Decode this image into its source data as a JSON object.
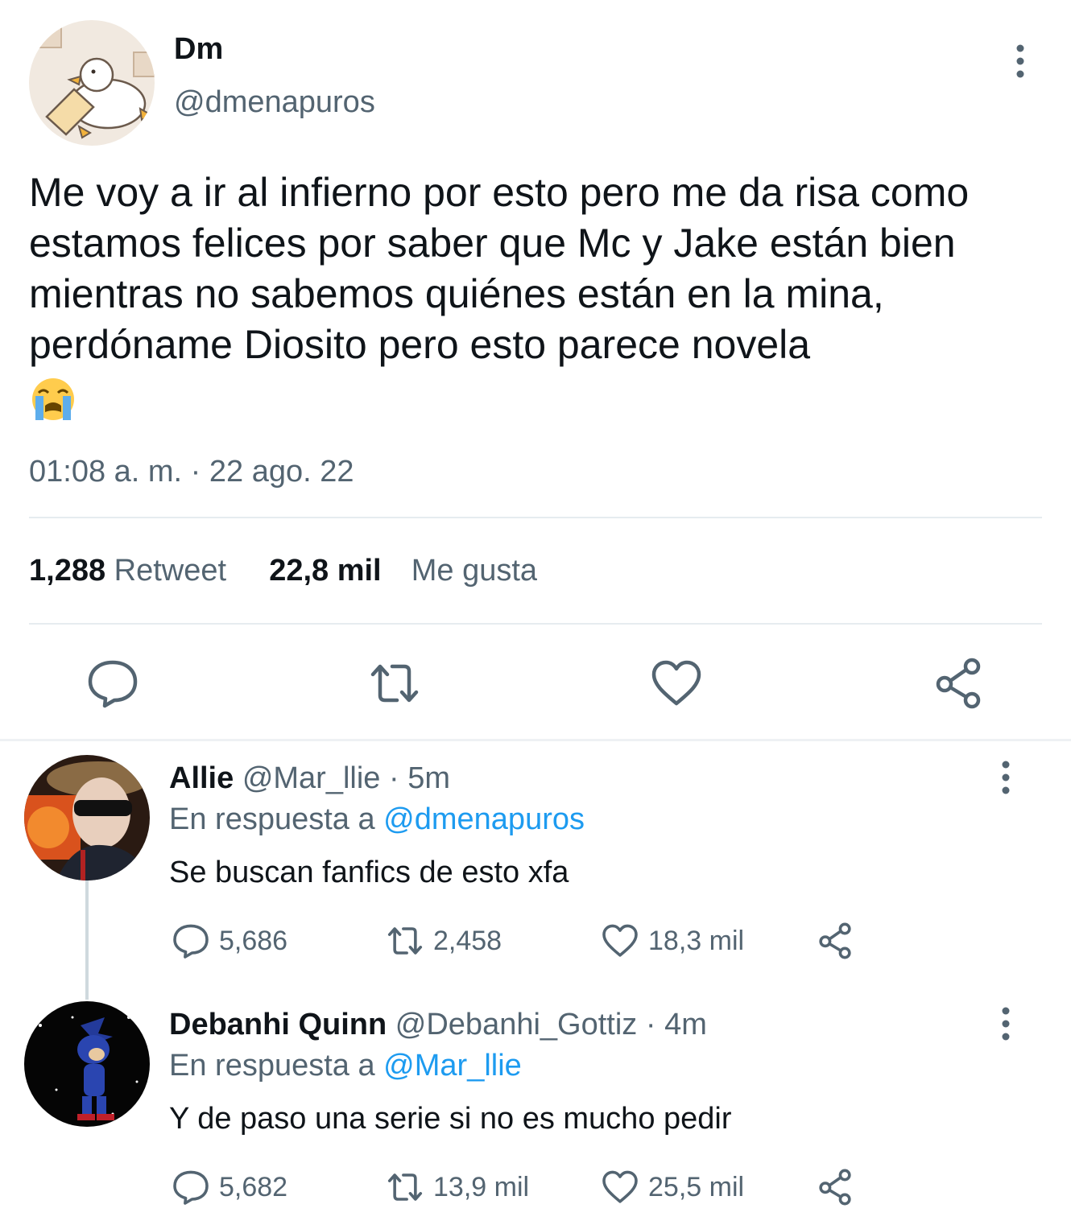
{
  "tweet": {
    "author_name": "Dm",
    "author_handle": "@dmenapuros",
    "text": "Me voy a ir al infierno por esto pero me da risa como estamos felices por saber que Mc y Jake están bien mientras no sabemos quiénes están en la mina, perdóname Diosito pero esto parece novela",
    "emoji": "loudly-crying-face",
    "timestamp": "01:08 a. m. · 22 ago. 22",
    "retweet_count": "1,288",
    "retweet_label": "Retweet",
    "like_count": "22,8 mil",
    "like_label": "Me gusta",
    "icons": [
      "reply-icon",
      "retweet-icon",
      "like-icon",
      "share-icon",
      "more-icon"
    ]
  },
  "replies": [
    {
      "name": "Allie",
      "meta": "@Mar_llie · 5m",
      "reply_prefix": "En respuesta a ",
      "reply_target": "@dmenapuros",
      "text": "Se buscan fanfics de esto xfa",
      "reply_count": "5,686",
      "retweet_count": "2,458",
      "like_count": "18,3 mil"
    },
    {
      "name": "Debanhi Quinn",
      "meta": "@Debanhi_Gottiz · 4m",
      "reply_prefix": "En respuesta a ",
      "reply_target": "@Mar_llie",
      "text": "Y de paso una serie si no es mucho pedir",
      "reply_count": "5,682",
      "retweet_count": "13,9 mil",
      "like_count": "25,5 mil"
    }
  ],
  "colors": {
    "text_primary": "#0f1419",
    "text_secondary": "#536471",
    "link": "#1d9bf0",
    "divider": "#e6ecf0"
  }
}
